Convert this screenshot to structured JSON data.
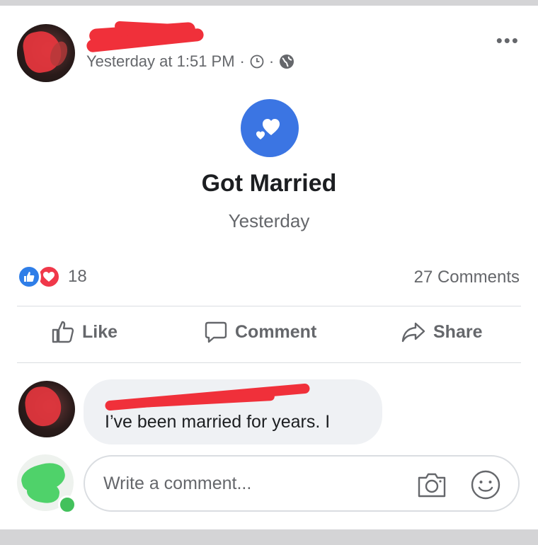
{
  "post": {
    "timestamp": "Yesterday at 1:51 PM",
    "separator": "·",
    "more_label": "•••",
    "icons": [
      "clock-icon",
      "globe-icon",
      "more-options-icon"
    ]
  },
  "life_event": {
    "icon": "hearts-icon",
    "title": "Got Married",
    "subtitle": "Yesterday",
    "icon_color": "#3b75e3"
  },
  "reactions": {
    "types": [
      "like-reaction-icon",
      "love-reaction-icon"
    ],
    "count": "18",
    "comments": "27 Comments"
  },
  "actions": {
    "like": "Like",
    "comment": "Comment",
    "share": "Share"
  },
  "comment": {
    "text": "I’ve been married for years. I"
  },
  "composer": {
    "placeholder": "Write a comment...",
    "icons": [
      "camera-icon",
      "emoji-icon"
    ]
  },
  "colors": {
    "accent": "#3b75e3",
    "redaction": "#f0303a",
    "muted_text": "#65676b",
    "online": "#43c15c"
  }
}
